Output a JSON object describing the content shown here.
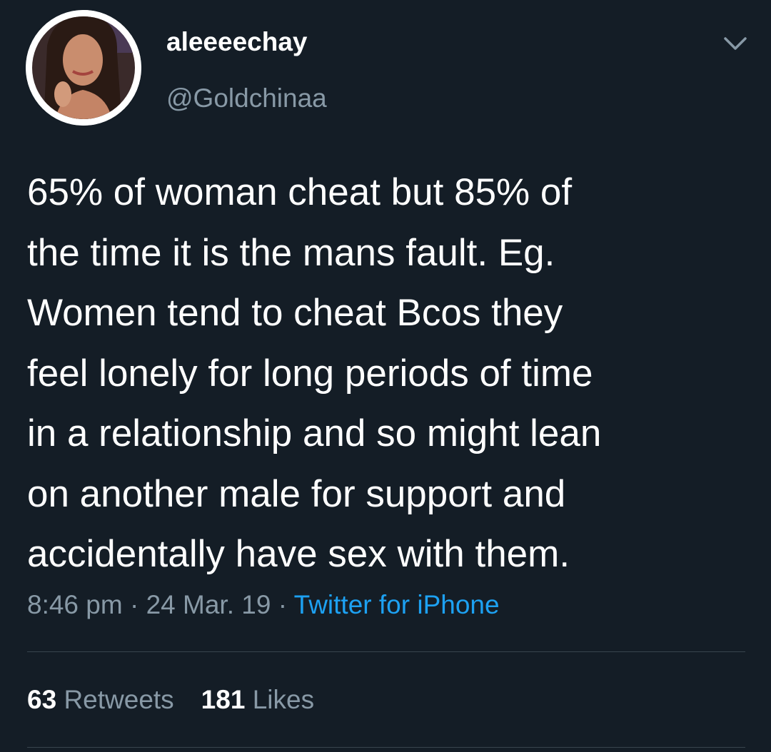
{
  "user": {
    "display_name": "aleeeechay",
    "handle": "@Goldchinaa"
  },
  "tweet": {
    "lines": [
      "65% of woman cheat but 85% of",
      "the time it is the mans fault. Eg.",
      "Women tend to cheat Bcos they",
      "feel lonely for long periods of time",
      "in a relationship and so might lean",
      "on another male for support and",
      "accidentally have sex with them."
    ]
  },
  "meta": {
    "time": "8:46 pm",
    "separator": " · ",
    "date": "24 Mar. 19",
    "source": "Twitter for iPhone"
  },
  "stats": {
    "retweets_count": "63",
    "retweets_label": "Retweets",
    "likes_count": "181",
    "likes_label": "Likes"
  },
  "icons": {
    "menu": "chevron-down-icon",
    "avatar": "avatar"
  },
  "colors": {
    "background": "#141d26",
    "primary_text": "#ffffff",
    "secondary_text": "#8899a6",
    "link": "#1da1f2",
    "divider": "#38444d"
  }
}
